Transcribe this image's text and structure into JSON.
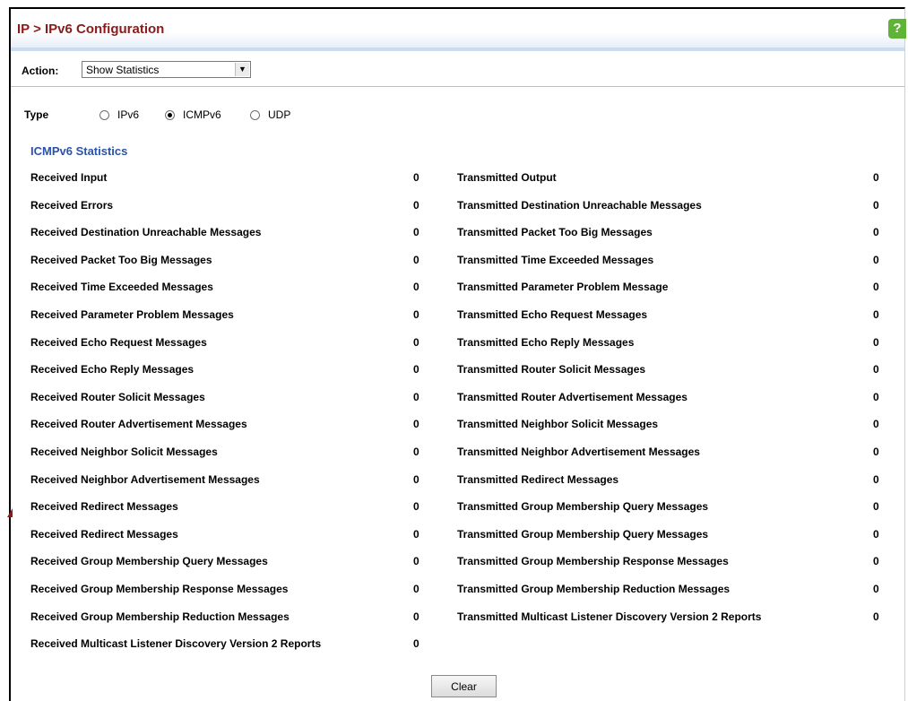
{
  "header": {
    "title": "IP > IPv6 Configuration",
    "help_icon": "?"
  },
  "action": {
    "label": "Action:",
    "selected": "Show Statistics"
  },
  "type_selector": {
    "label": "Type",
    "options": [
      {
        "label": "IPv6",
        "checked": false
      },
      {
        "label": "ICMPv6",
        "checked": true
      },
      {
        "label": "UDP",
        "checked": false
      }
    ]
  },
  "stats": {
    "title": "ICMPv6 Statistics",
    "received": [
      {
        "label": "Received Input",
        "value": "0"
      },
      {
        "label": "Received Errors",
        "value": "0"
      },
      {
        "label": "Received Destination Unreachable Messages",
        "value": "0"
      },
      {
        "label": "Received Packet Too Big Messages",
        "value": "0"
      },
      {
        "label": "Received Time Exceeded Messages",
        "value": "0"
      },
      {
        "label": "Received Parameter Problem Messages",
        "value": "0"
      },
      {
        "label": "Received Echo Request Messages",
        "value": "0"
      },
      {
        "label": "Received Echo Reply Messages",
        "value": "0"
      },
      {
        "label": "Received Router Solicit Messages",
        "value": "0"
      },
      {
        "label": "Received Router Advertisement Messages",
        "value": "0"
      },
      {
        "label": "Received Neighbor Solicit Messages",
        "value": "0"
      },
      {
        "label": "Received Neighbor Advertisement Messages",
        "value": "0"
      },
      {
        "label": "Received Redirect Messages",
        "value": "0"
      },
      {
        "label": "Received Redirect Messages",
        "value": "0"
      },
      {
        "label": "Received Group Membership Query Messages",
        "value": "0"
      },
      {
        "label": "Received Group Membership Response Messages",
        "value": "0"
      },
      {
        "label": "Received Group Membership Reduction Messages",
        "value": "0"
      },
      {
        "label": "Received Multicast Listener Discovery Version 2 Reports",
        "value": "0"
      }
    ],
    "transmitted": [
      {
        "label": "Transmitted Output",
        "value": "0"
      },
      {
        "label": "Transmitted Destination Unreachable Messages",
        "value": "0"
      },
      {
        "label": "Transmitted Packet Too Big Messages",
        "value": "0"
      },
      {
        "label": "Transmitted Time Exceeded Messages",
        "value": "0"
      },
      {
        "label": "Transmitted Parameter Problem Message",
        "value": "0"
      },
      {
        "label": "Transmitted Echo Request Messages",
        "value": "0"
      },
      {
        "label": "Transmitted Echo Reply Messages",
        "value": "0"
      },
      {
        "label": "Transmitted Router Solicit Messages",
        "value": "0"
      },
      {
        "label": "Transmitted Router Advertisement Messages",
        "value": "0"
      },
      {
        "label": "Transmitted Neighbor Solicit Messages",
        "value": "0"
      },
      {
        "label": "Transmitted Neighbor Advertisement Messages",
        "value": "0"
      },
      {
        "label": "Transmitted Redirect Messages",
        "value": "0"
      },
      {
        "label": "Transmitted Group Membership Query Messages",
        "value": "0"
      },
      {
        "label": "Transmitted Group Membership Query Messages",
        "value": "0"
      },
      {
        "label": "Transmitted Group Membership Response Messages",
        "value": "0"
      },
      {
        "label": "Transmitted Group Membership Reduction Messages",
        "value": "0"
      },
      {
        "label": "Transmitted Multicast Listener Discovery Version 2 Reports",
        "value": "0"
      }
    ]
  },
  "buttons": {
    "clear": "Clear"
  }
}
